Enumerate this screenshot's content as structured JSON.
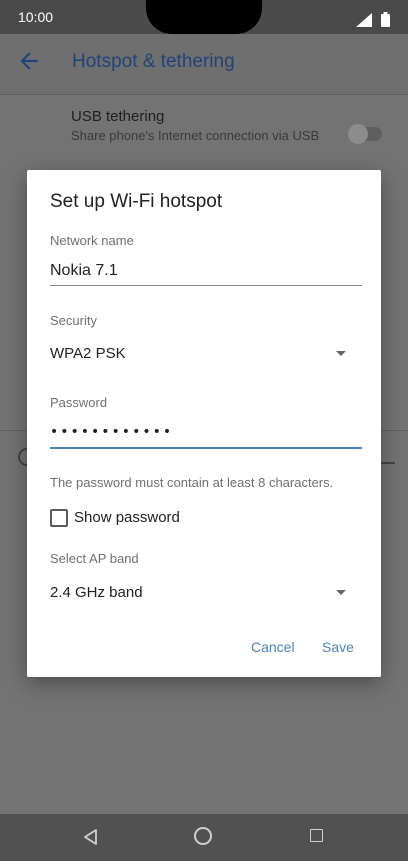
{
  "status_bar": {
    "time": "10:00"
  },
  "app_bar": {
    "title": "Hotspot & tethering",
    "back_icon": "arrow-left-icon"
  },
  "background": {
    "usb_tethering": {
      "title": "USB tethering",
      "subtitle": "Share phone's Internet connection via USB"
    }
  },
  "dialog": {
    "title": "Set up Wi-Fi hotspot",
    "network_name": {
      "label": "Network name",
      "value": "Nokia 7.1"
    },
    "security": {
      "label": "Security",
      "value": "WPA2 PSK"
    },
    "password": {
      "label": "Password",
      "value": "••••••••••••"
    },
    "hint": "The password must contain at least 8 characters.",
    "show_password": "Show password",
    "ap_band": {
      "label": "Select AP band",
      "value": "2.4 GHz band"
    },
    "cancel": "Cancel",
    "save": "Save"
  },
  "colors": {
    "accent": "#4a7fc1",
    "app_title": "#22427a"
  }
}
